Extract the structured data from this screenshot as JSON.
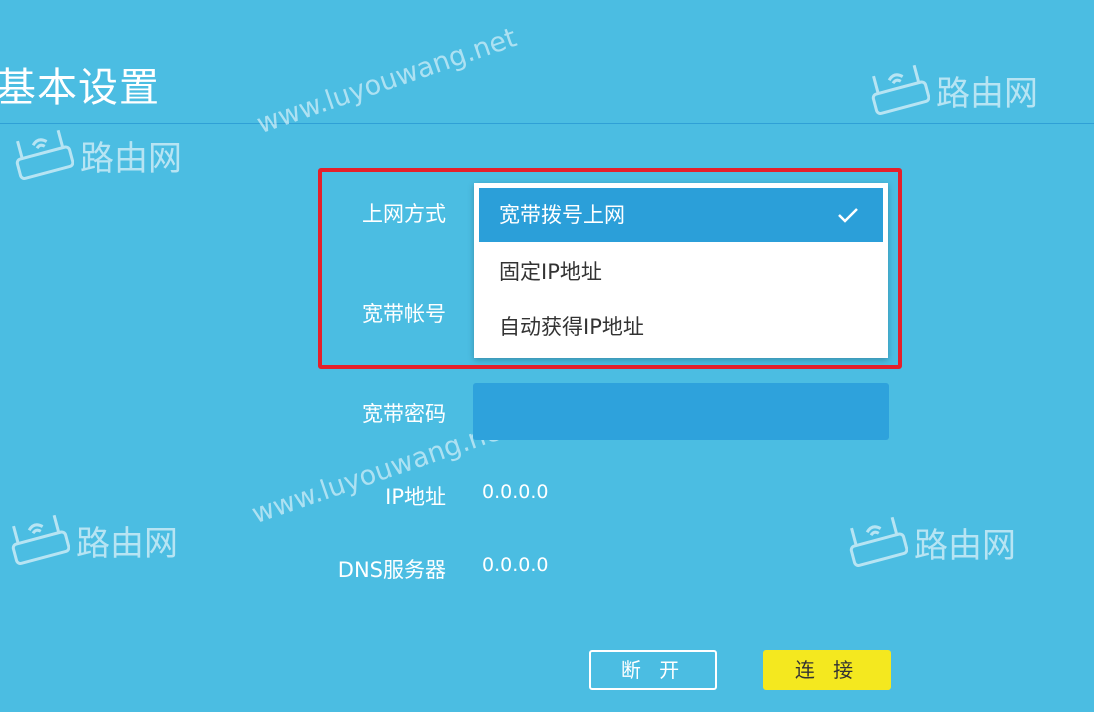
{
  "page": {
    "title": "基本设置"
  },
  "form": {
    "connection_type_label": "上网方式",
    "account_label": "宽带帐号",
    "password_label": "宽带密码",
    "password_value": "",
    "ip_label": "IP地址",
    "ip_value": "0.0.0.0",
    "dns_label": "DNS服务器",
    "dns_value": "0.0.0.0"
  },
  "dropdown": {
    "options": [
      {
        "label": "宽带拨号上网",
        "selected": true
      },
      {
        "label": "固定IP地址",
        "selected": false
      },
      {
        "label": "自动获得IP地址",
        "selected": false
      }
    ]
  },
  "buttons": {
    "disconnect": "断 开",
    "connect": "连 接"
  },
  "watermark": {
    "url": "www.luyouwang.net",
    "logo": "路由网"
  },
  "colors": {
    "background": "#4bbde2",
    "highlight": "#e4202b",
    "selected_option": "#2b9fd9",
    "connect_button": "#f4e81f"
  }
}
